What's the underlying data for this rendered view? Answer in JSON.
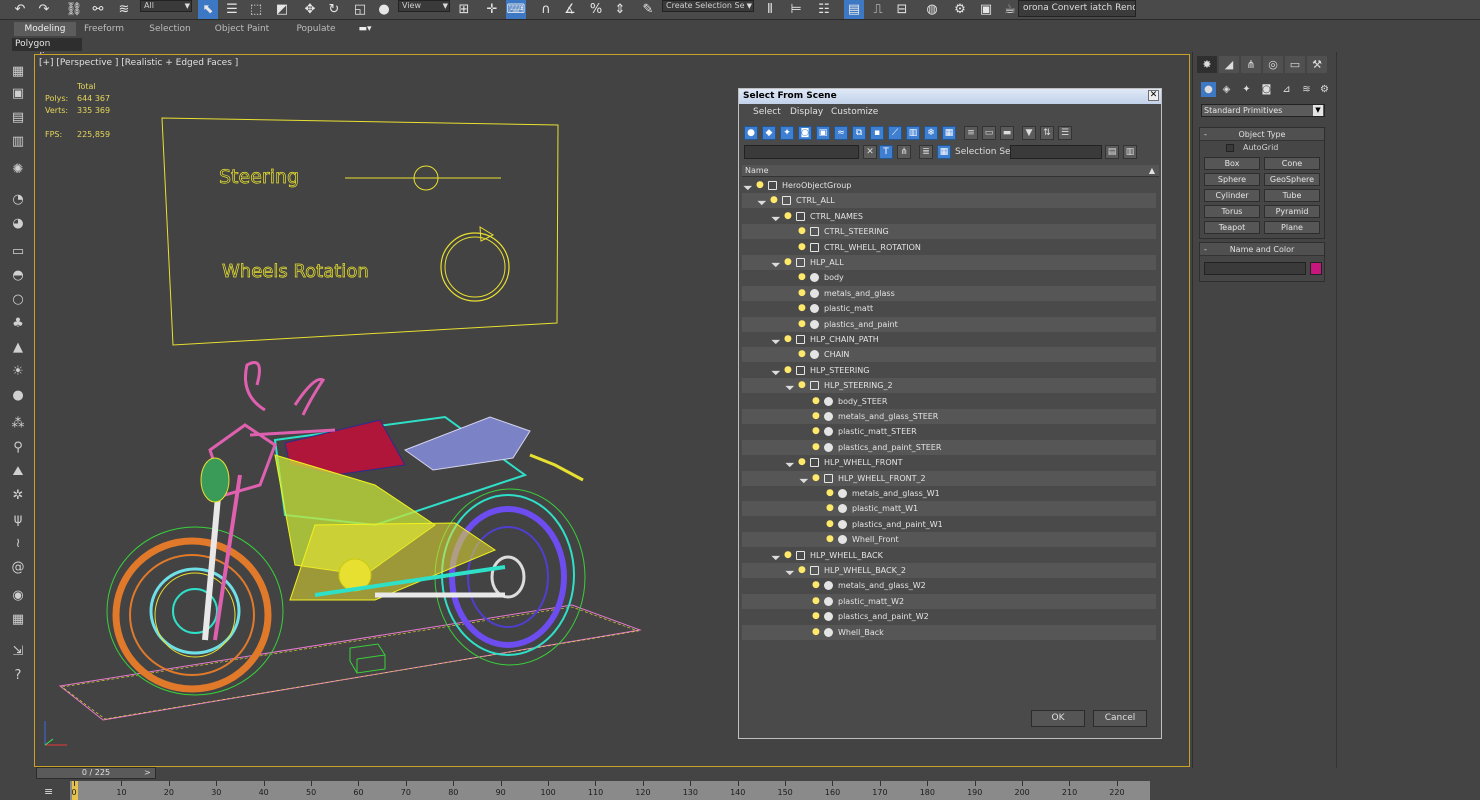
{
  "toolbar": {
    "filter_value": "All",
    "ref_coord": "View",
    "selection_set_placeholder": "Create Selection Se",
    "render_text": "orona Convert iatch Render..."
  },
  "ribbon": {
    "tabs": [
      {
        "label": "Modeling",
        "active": true
      },
      {
        "label": "Freeform",
        "active": false
      },
      {
        "label": "Selection",
        "active": false
      },
      {
        "label": "Object Paint",
        "active": false
      },
      {
        "label": "Populate",
        "active": false
      }
    ],
    "subpanel": "Polygon Modeling"
  },
  "viewport": {
    "label": "[+] [Perspective ] [Realistic + Edged Faces ]",
    "stats": {
      "total_label": "Total",
      "polys_label": "Polys:",
      "polys_value": "644 367",
      "verts_label": "Verts:",
      "verts_value": "335 369",
      "fps_label": "FPS:",
      "fps_value": "225,859"
    },
    "ui_panel": {
      "steering_label": "Steering",
      "wheels_label": "Wheels Rotation"
    }
  },
  "dialog": {
    "title": "Select From Scene",
    "menu": [
      "Select",
      "Display",
      "Customize"
    ],
    "selection_set_label": "Selection Set:",
    "column_header": "Name",
    "tree": [
      {
        "label": "HeroObjectGroup",
        "depth": 0,
        "type": "group",
        "expanded": true
      },
      {
        "label": "CTRL_ALL",
        "depth": 1,
        "type": "group",
        "expanded": true
      },
      {
        "label": "CTRL_NAMES",
        "depth": 2,
        "type": "group",
        "expanded": true
      },
      {
        "label": "CTRL_STEERING",
        "depth": 3,
        "type": "group",
        "expanded": false
      },
      {
        "label": "CTRL_WHELL_ROTATION",
        "depth": 3,
        "type": "group",
        "expanded": false
      },
      {
        "label": "HLP_ALL",
        "depth": 2,
        "type": "helper",
        "expanded": true
      },
      {
        "label": "body",
        "depth": 3,
        "type": "object",
        "expanded": false
      },
      {
        "label": "metals_and_glass",
        "depth": 3,
        "type": "object",
        "expanded": false
      },
      {
        "label": "plastic_matt",
        "depth": 3,
        "type": "object",
        "expanded": false
      },
      {
        "label": "plastics_and_paint",
        "depth": 3,
        "type": "object",
        "expanded": false
      },
      {
        "label": "HLP_CHAIN_PATH",
        "depth": 2,
        "type": "helper",
        "expanded": true
      },
      {
        "label": "CHAIN",
        "depth": 3,
        "type": "object",
        "expanded": false
      },
      {
        "label": "HLP_STEERING",
        "depth": 2,
        "type": "helper",
        "expanded": true
      },
      {
        "label": "HLP_STEERING_2",
        "depth": 3,
        "type": "helper",
        "expanded": true
      },
      {
        "label": "body_STEER",
        "depth": 4,
        "type": "object",
        "expanded": false
      },
      {
        "label": "metals_and_glass_STEER",
        "depth": 4,
        "type": "object",
        "expanded": false
      },
      {
        "label": "plastic_matt_STEER",
        "depth": 4,
        "type": "object",
        "expanded": false
      },
      {
        "label": "plastics_and_paint_STEER",
        "depth": 4,
        "type": "object",
        "expanded": false
      },
      {
        "label": "HLP_WHELL_FRONT",
        "depth": 3,
        "type": "helper",
        "expanded": true
      },
      {
        "label": "HLP_WHELL_FRONT_2",
        "depth": 4,
        "type": "helper",
        "expanded": true
      },
      {
        "label": "metals_and_glass_W1",
        "depth": 5,
        "type": "object",
        "expanded": false
      },
      {
        "label": "plastic_matt_W1",
        "depth": 5,
        "type": "object",
        "expanded": false
      },
      {
        "label": "plastics_and_paint_W1",
        "depth": 5,
        "type": "object",
        "expanded": false
      },
      {
        "label": "Whell_Front",
        "depth": 5,
        "type": "object",
        "expanded": false
      },
      {
        "label": "HLP_WHELL_BACK",
        "depth": 2,
        "type": "helper",
        "expanded": true
      },
      {
        "label": "HLP_WHELL_BACK_2",
        "depth": 3,
        "type": "helper",
        "expanded": true
      },
      {
        "label": "metals_and_glass_W2",
        "depth": 4,
        "type": "object",
        "expanded": false
      },
      {
        "label": "plastic_matt_W2",
        "depth": 4,
        "type": "object",
        "expanded": false
      },
      {
        "label": "plastics_and_paint_W2",
        "depth": 4,
        "type": "object",
        "expanded": false
      },
      {
        "label": "Whell_Back",
        "depth": 4,
        "type": "object",
        "expanded": false
      }
    ],
    "ok_label": "OK",
    "cancel_label": "Cancel"
  },
  "command_panel": {
    "primitive_type": "Standard Primitives",
    "object_type_title": "Object Type",
    "autogrid_label": "AutoGrid",
    "buttons": [
      "Box",
      "Cone",
      "Sphere",
      "GeoSphere",
      "Cylinder",
      "Tube",
      "Torus",
      "Pyramid",
      "Teapot",
      "Plane"
    ],
    "name_color_title": "Name and Color",
    "object_color": "#c7167d"
  },
  "timeline": {
    "frame_display": "0 / 225",
    "ticks": [
      "0",
      "10",
      "20",
      "30",
      "40",
      "50",
      "60",
      "70",
      "80",
      "90",
      "100",
      "110",
      "120",
      "130",
      "140",
      "150",
      "160",
      "170",
      "180",
      "190",
      "200",
      "210",
      "220"
    ]
  },
  "colors": {
    "accent": "#3d78c4",
    "viewport_border": "#c9a227",
    "stats_text": "#e6d65a",
    "helper_yellow": "#e8e030"
  }
}
